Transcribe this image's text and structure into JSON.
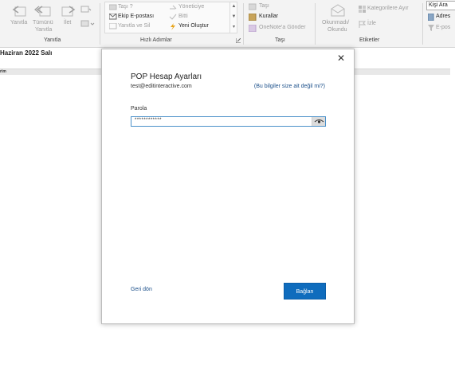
{
  "ribbon": {
    "reply_group": {
      "reply": "Yanıtla",
      "reply_all_line1": "Tümünü",
      "reply_all_line2": "Yanıtla",
      "forward": "İlet",
      "group_label": "Yanıtla"
    },
    "quick_steps": {
      "move_to": "Taşı ?",
      "manager": "Yöneticiye",
      "team_email": "Ekip E-postası",
      "done": "Bitti",
      "reply_delete": "Yanıtla ve Sil",
      "create_new": "Yeni Oluştur",
      "group_label": "Hızlı Adımlar"
    },
    "move_group": {
      "move": "Taşı",
      "rules": "Kurallar",
      "onenote": "OneNote'a Gönder",
      "group_label": "Taşı"
    },
    "tags_group": {
      "read_unread_line1": "Okunmadı/",
      "read_unread_line2": "Okundu",
      "categorize": "Kategorilere Ayır",
      "follow_up": "İzle",
      "group_label": "Etiketler"
    },
    "find_group": {
      "search_people": "Kişi Ara",
      "address_book": "Adres",
      "filter_email": "E-pos"
    }
  },
  "content": {
    "date_heading": "Haziran 2022 Salı",
    "calendar_row_label": "rim"
  },
  "dialog": {
    "title": "POP Hesap Ayarları",
    "email": "test@editinteractive.com",
    "not_you_link": "(Bu bilgiler size ait değil mi?)",
    "password_label": "Parola",
    "password_value": "************",
    "back_link": "Geri dön",
    "connect_button": "Bağlan",
    "close_glyph": "✕"
  },
  "icons": [
    "reply-icon",
    "reply-all-icon",
    "forward-icon",
    "more-icon",
    "rules-icon",
    "envelope-icon",
    "tag-icon",
    "flag-icon",
    "eye-icon"
  ],
  "colors": {
    "accent": "#0f6cbd",
    "link": "#1b4f8a",
    "ribbon_bg": "#f3f3f3",
    "field_border": "#4a90c9"
  }
}
